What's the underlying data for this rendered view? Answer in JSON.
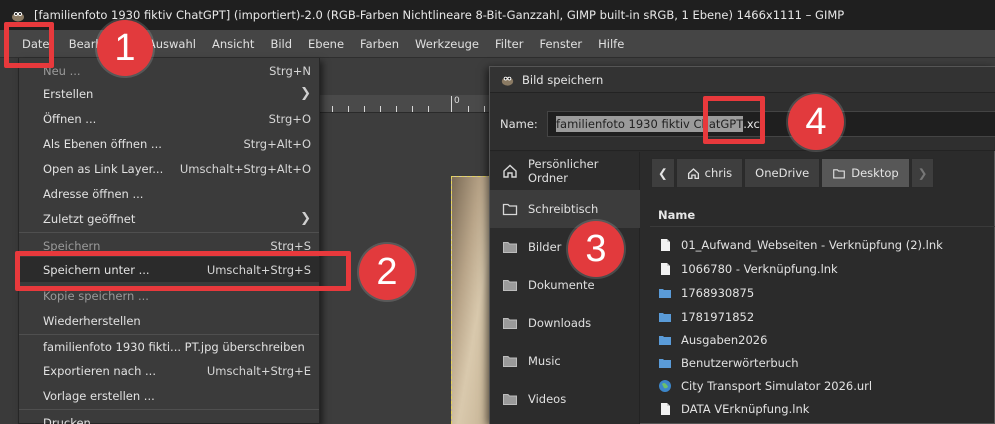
{
  "window": {
    "title": "[familienfoto 1930 fiktiv ChatGPT] (importiert)-2.0 (RGB-Farben Nichtlineare 8-Bit-Ganzzahl, GIMP built-in sRGB, 1 Ebene) 1466x1111 – GIMP"
  },
  "menubar": {
    "items": [
      "Datei",
      "Bearbeiten",
      "Auswahl",
      "Ansicht",
      "Bild",
      "Ebene",
      "Farben",
      "Werkzeuge",
      "Filter",
      "Fenster",
      "Hilfe"
    ]
  },
  "ruler": {
    "zero_label": "0"
  },
  "file_menu": {
    "items": [
      {
        "label": "Neu ...",
        "shortcut": "Strg+N"
      },
      {
        "label": "Erstellen",
        "shortcut": ""
      },
      {
        "label": "Öffnen ...",
        "shortcut": "Strg+O"
      },
      {
        "label": "Als Ebenen öffnen ...",
        "shortcut": "Strg+Alt+O"
      },
      {
        "label": "Open as Link Layer...",
        "shortcut": "Umschalt+Strg+Alt+O"
      },
      {
        "label": "Adresse öffnen ...",
        "shortcut": ""
      },
      {
        "label": "Zuletzt geöffnet",
        "shortcut": ""
      },
      {
        "label": "Speichern",
        "shortcut": "Strg+S"
      },
      {
        "label": "Speichern unter ...",
        "shortcut": "Umschalt+Strg+S"
      },
      {
        "label": "Kopie speichern ...",
        "shortcut": ""
      },
      {
        "label": "Wiederherstellen",
        "shortcut": ""
      },
      {
        "label": "familienfoto 1930 fikti... PT.jpg überschreiben",
        "shortcut": ""
      },
      {
        "label": "Exportieren nach ...",
        "shortcut": "Umschalt+Strg+E"
      },
      {
        "label": "Vorlage erstellen ...",
        "shortcut": ""
      },
      {
        "label": "Drucken ...",
        "shortcut": ""
      }
    ]
  },
  "dialog": {
    "title": "Bild speichern",
    "name_label": "Name:",
    "filename_selected": "familienfoto 1930 fiktiv ChatGPT",
    "filename_ext": ".xcf",
    "places": [
      "Persönlicher Ordner",
      "Schreibtisch",
      "Bilder",
      "Dokumente",
      "Downloads",
      "Music",
      "Videos"
    ],
    "path": [
      "chris",
      "OneDrive",
      "Desktop"
    ],
    "column_name": "Name",
    "files": [
      {
        "name": "01_Aufwand_Webseiten - Verknüpfung (2).lnk",
        "type": "file"
      },
      {
        "name": "1066780 - Verknüpfung.lnk",
        "type": "file"
      },
      {
        "name": "1768930875",
        "type": "folder"
      },
      {
        "name": "1781971852",
        "type": "folder"
      },
      {
        "name": "Ausgaben2026",
        "type": "folder"
      },
      {
        "name": "Benutzerwörterbuch",
        "type": "folder"
      },
      {
        "name": "City Transport Simulator 2026.url",
        "type": "url"
      },
      {
        "name": "DATA VErknüpfung.lnk",
        "type": "file"
      }
    ]
  },
  "annotations": {
    "badges": [
      "1",
      "2",
      "3",
      "4"
    ],
    "color": "#e23a3d"
  },
  "colors": {
    "menu_bg": "#3b3b3b",
    "dialog_bg": "#2b2b2b",
    "folder_blue": "#5a9bd8",
    "selection_yellow": "#e4d35a"
  }
}
